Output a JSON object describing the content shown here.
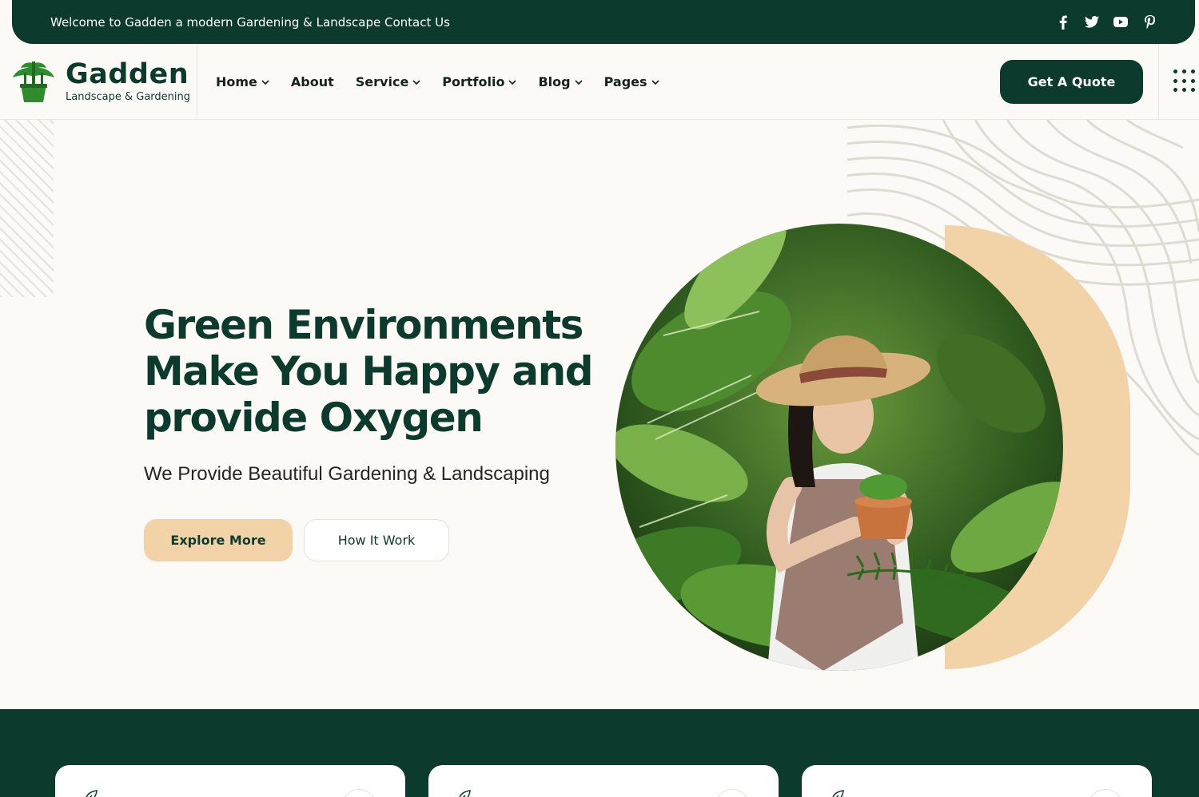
{
  "topbar": {
    "welcome": "Welcome to Gadden a modern Gardening & Landscape Contact Us",
    "socials": [
      "facebook-icon",
      "twitter-icon",
      "youtube-icon",
      "pinterest-icon"
    ]
  },
  "brand": {
    "name": "Gadden",
    "tagline": "Landscape & Gardening"
  },
  "nav": {
    "items": [
      {
        "label": "Home",
        "dropdown": true
      },
      {
        "label": "About",
        "dropdown": false
      },
      {
        "label": "Service",
        "dropdown": true
      },
      {
        "label": "Portfolio",
        "dropdown": true
      },
      {
        "label": "Blog",
        "dropdown": true
      },
      {
        "label": "Pages",
        "dropdown": true
      }
    ],
    "cta": "Get A Quote"
  },
  "hero": {
    "title": "Green Environments Make You Happy and provide Oxygen",
    "subtitle": "We Provide Beautiful Gardening & Landscaping",
    "primary_button": "Explore More",
    "secondary_button": "How It Work"
  },
  "colors": {
    "primary": "#0c3b2e",
    "accent": "#f2d3a7",
    "background": "#fcfaf6"
  }
}
